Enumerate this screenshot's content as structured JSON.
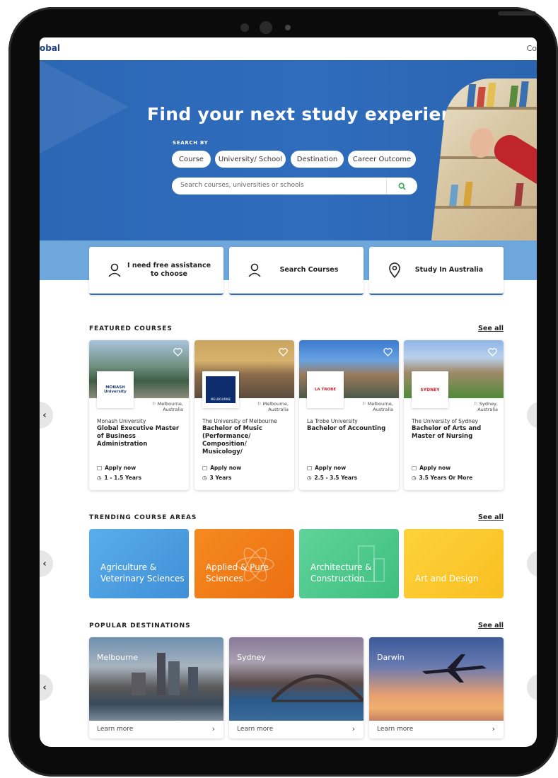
{
  "header": {
    "logo_fragment": "obal",
    "nav_fragment": "Co"
  },
  "hero": {
    "title": "Find your next study experience",
    "search_by_label": "SEARCH BY",
    "tabs": [
      "Course",
      "University/ School",
      "Destination",
      "Career Outcome"
    ],
    "search_placeholder": "Search courses, universities or schools"
  },
  "actions": [
    {
      "label": "I need free assistance to choose",
      "icon": "person-icon"
    },
    {
      "label": "Search Courses",
      "icon": "person-icon"
    },
    {
      "label": "Study In Australia",
      "icon": "location-pin-icon"
    }
  ],
  "featured": {
    "title": "FEATURED COURSES",
    "see_all": "See all",
    "courses": [
      {
        "logo_text": "MONASH University",
        "location_line1": "Melbourne,",
        "location_line2": "Australia",
        "university": "Monash University",
        "course": "Global Executive Master of Business Administration",
        "apply": "Apply now",
        "duration": "1 - 1.5 Years"
      },
      {
        "logo_text": "MELBOURNE",
        "location_line1": "Melbourne,",
        "location_line2": "Australia",
        "university": "The University of Melbourne",
        "course": "Bachelor of Music (Performance/ Composition/ Musicology/",
        "apply": "Apply now",
        "duration": "3 Years"
      },
      {
        "logo_text": "LA TROBE",
        "location_line1": "Melbourne,",
        "location_line2": "Australia",
        "university": "La Trobe University",
        "course": "Bachelor of Accounting",
        "apply": "Apply now",
        "duration": "2.5 - 3.5 Years"
      },
      {
        "logo_text": "SYDNEY",
        "location_line1": "Sydney,",
        "location_line2": "Australia",
        "university": "The University of Sydney",
        "course": "Bachelor of Arts and Master of Nursing",
        "apply": "Apply now",
        "duration": "3.5 Years Or More"
      }
    ]
  },
  "trending": {
    "title": "TRENDING COURSE AREAS",
    "see_all": "See all",
    "areas": [
      {
        "label": "Agriculture & Veterinary Sciences",
        "color": "#4a9fe0"
      },
      {
        "label": "Applied & Pure Sciences",
        "color": "#f07e1a"
      },
      {
        "label": "Architecture & Construction",
        "color": "#4ecb8d"
      },
      {
        "label": "Art and Design",
        "color": "#fbc52a"
      }
    ]
  },
  "destinations": {
    "title": "POPULAR DESTINATIONS",
    "see_all": "See all",
    "items": [
      {
        "name": "Melbourne",
        "cta": "Learn more"
      },
      {
        "name": "Sydney",
        "cta": "Learn more"
      },
      {
        "name": "Darwin",
        "cta": "Learn more"
      }
    ]
  },
  "nav_arrows": {
    "prev": "‹"
  },
  "colors": {
    "primary": "#2f6cbc",
    "green_icon": "#3aa655"
  }
}
